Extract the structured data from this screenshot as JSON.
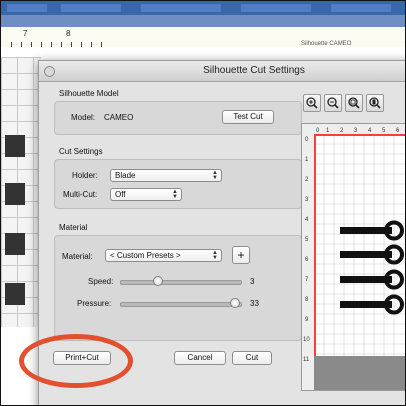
{
  "background_app": {
    "ruler_labels": [
      "7",
      "8"
    ],
    "tab_label": "Silhouette CAMEO"
  },
  "dialog": {
    "title": "Silhouette Cut Settings",
    "model_section": {
      "heading": "Silhouette Model",
      "model_label": "Model:",
      "model_value": "CAMEO",
      "test_cut_label": "Test Cut"
    },
    "cut_settings": {
      "heading": "Cut Settings",
      "holder_label": "Holder:",
      "holder_value": "Blade",
      "multicut_label": "Multi-Cut:",
      "multicut_value": "Off"
    },
    "material": {
      "heading": "Material",
      "material_label": "Material:",
      "material_value": "< Custom Presets >",
      "add_label": "+",
      "speed_label": "Speed:",
      "speed_value": "3",
      "speed_fraction": 0.3,
      "pressure_label": "Pressure:",
      "pressure_value": "33",
      "pressure_fraction": 1.0
    },
    "buttons": {
      "print_cut": "Print+Cut",
      "cancel": "Cancel",
      "cut": "Cut"
    },
    "zoom_icons": [
      "zoom-in-icon",
      "zoom-out-icon",
      "zoom-fit-icon",
      "zoom-page-icon"
    ],
    "preview": {
      "ruler_top": [
        "0",
        "1",
        "2",
        "3",
        "4",
        "5",
        "6"
      ],
      "ruler_left": [
        "0",
        "1",
        "2",
        "3",
        "4",
        "5",
        "6",
        "7",
        "8",
        "9",
        "10",
        "11"
      ]
    }
  },
  "colors": {
    "highlight": "#e2502f",
    "bg_toolbar": "#3a67a8"
  }
}
